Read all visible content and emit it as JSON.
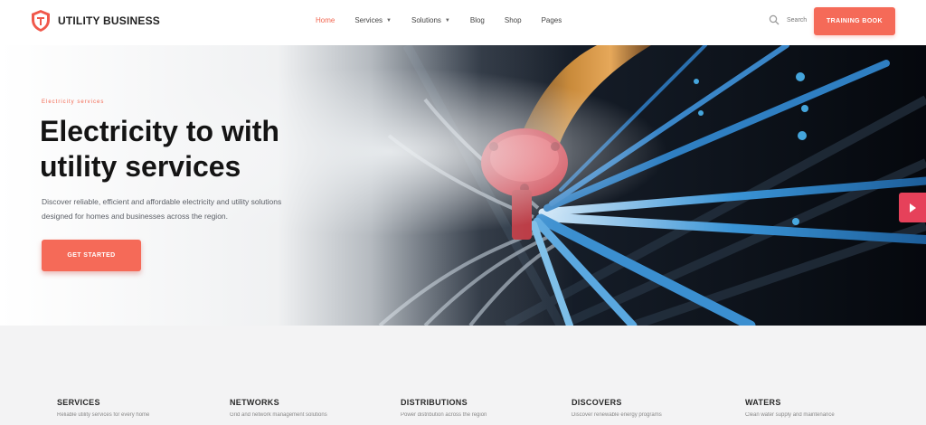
{
  "header": {
    "brand": "UTILITY BUSINESS",
    "nav": [
      {
        "label": "Home",
        "active": true,
        "dropdown": false
      },
      {
        "label": "Services",
        "active": false,
        "dropdown": true
      },
      {
        "label": "Solutions",
        "active": false,
        "dropdown": true
      },
      {
        "label": "Blog",
        "active": false,
        "dropdown": false
      },
      {
        "label": "Shop",
        "active": false,
        "dropdown": false
      },
      {
        "label": "Pages",
        "active": false,
        "dropdown": false
      }
    ],
    "search_label": "Search",
    "cta_label": "TRAINING BOOK"
  },
  "hero": {
    "eyebrow": "Electricity services",
    "title": "Electricity to with utility services",
    "description": "Discover reliable, efficient and affordable electricity and utility solutions designed for homes and businesses across the region.",
    "button_label": "GET STARTED"
  },
  "services": [
    {
      "title": "SERVICES",
      "desc": "Reliable utility services for every home"
    },
    {
      "title": "NETWORKS",
      "desc": "Grid and network management solutions"
    },
    {
      "title": "DISTRIBUTIONS",
      "desc": "Power distribution across the region"
    },
    {
      "title": "DISCOVERS",
      "desc": "Discover renewable energy programs"
    },
    {
      "title": "WATERS",
      "desc": "Clean water supply and maintenance"
    }
  ],
  "colors": {
    "accent": "#f56a58",
    "side_tab": "#e6415a",
    "dark": "#141414"
  }
}
